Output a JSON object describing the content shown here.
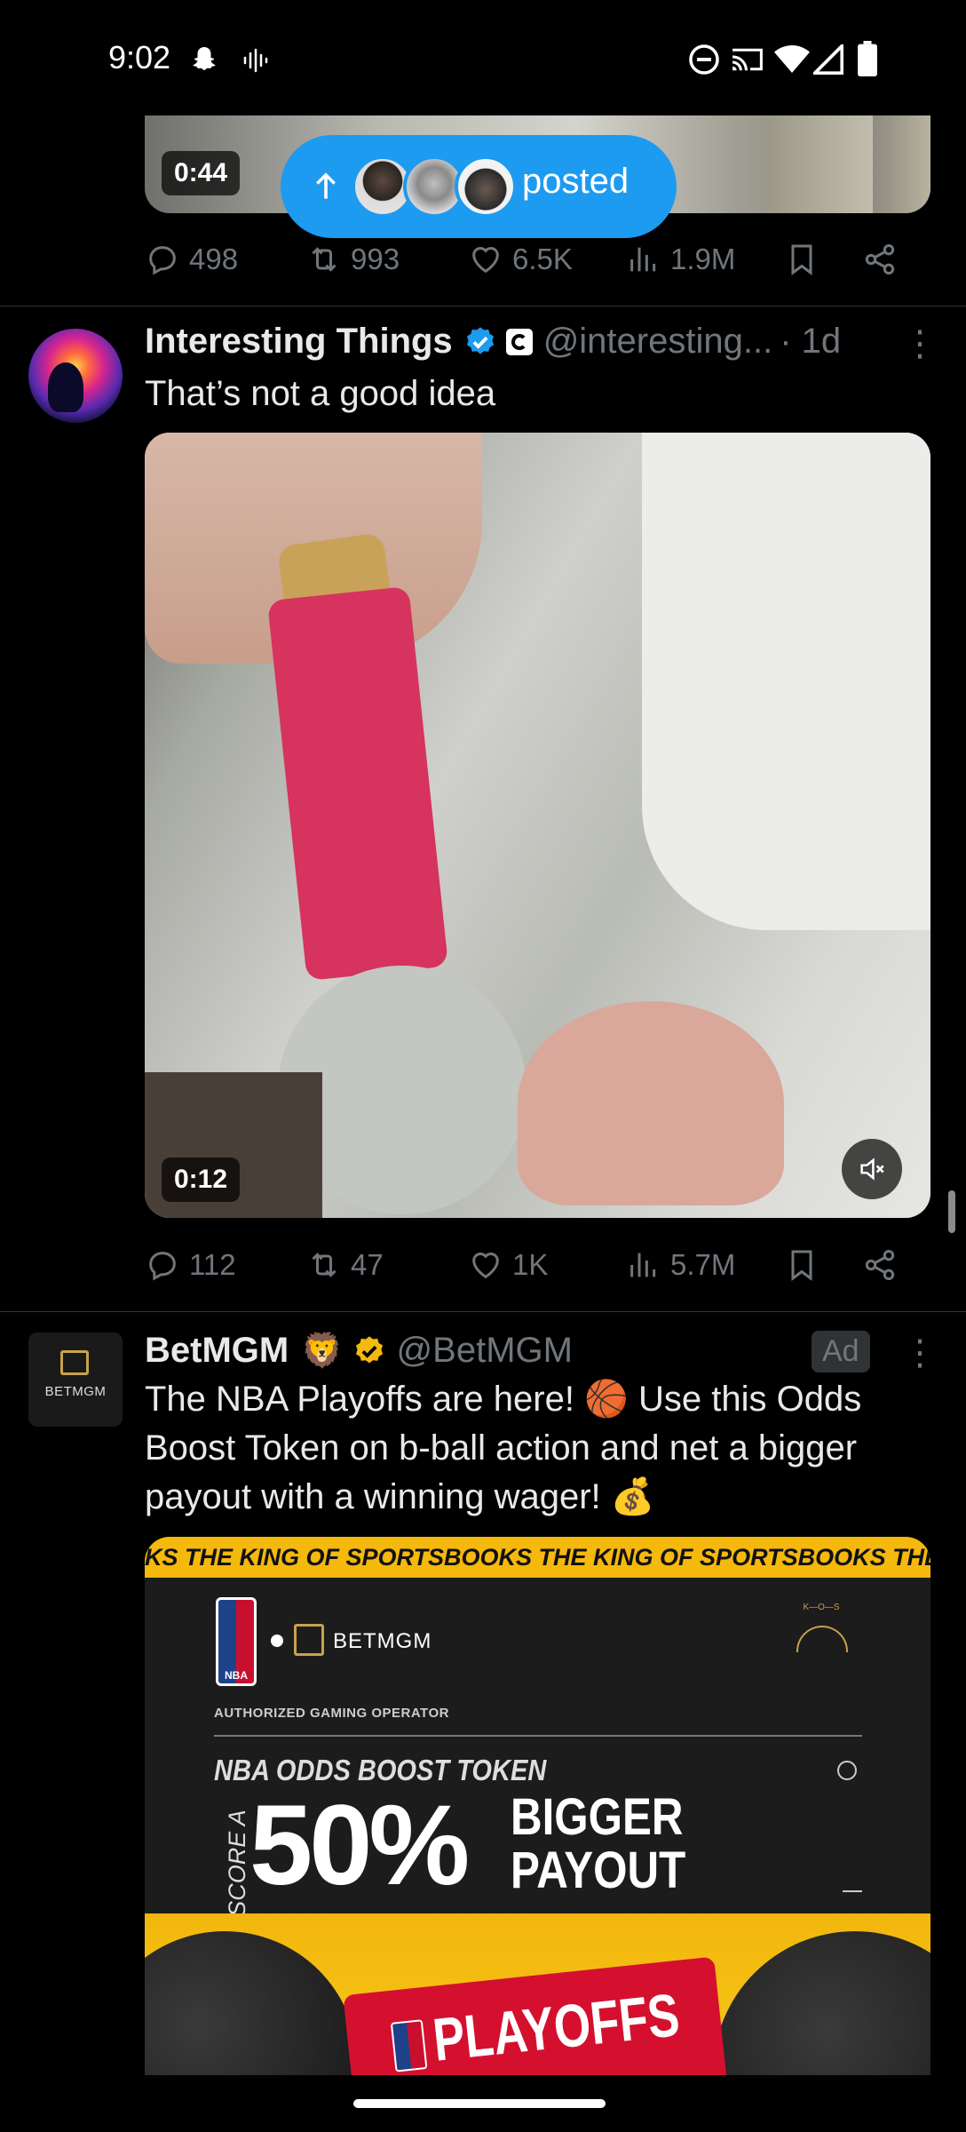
{
  "status_bar": {
    "time": "9:02"
  },
  "posted_pill": {
    "label": "posted"
  },
  "tweet_prev": {
    "video_duration": "0:44",
    "replies": "498",
    "reposts": "993",
    "likes": "6.5K",
    "views": "1.9M"
  },
  "tweet_main": {
    "name": "Interesting Things",
    "handle": "@interesting...",
    "time": "· 1d",
    "text": "That’s not a good idea",
    "video_duration": "0:12",
    "replies": "112",
    "reposts": "47",
    "likes": "1K",
    "views": "5.7M"
  },
  "tweet_ad": {
    "name": "BetMGM",
    "handle": "@BetMGM",
    "ad_label": "Ad",
    "avatar_text": "BETMGM",
    "text_lines": [
      "The NBA Playoffs are here! 🏀 Use this Odds",
      "Boost Token on b-ball action and net a bigger",
      "payout with a winning wager! 💰"
    ],
    "banner": {
      "ticker": "KS  THE KING OF SPORTSBOOKS  THE KING OF SPORTSBOOKS  THE",
      "nba_logo": "NBA",
      "brand": "BETMGM",
      "kos": "K—O—S",
      "authorized": "AUTHORIZED GAMING OPERATOR",
      "token": "NBA ODDS BOOST TOKEN",
      "score_a": "SCORE A",
      "big_number": "50%",
      "bigger": "BIGGER",
      "payout": "PAYOUT",
      "playoffs": "PLAYOFFS"
    }
  },
  "colors": {
    "accent": "#1d9bf0",
    "muted": "#71767b",
    "gold": "#f5b80c"
  }
}
